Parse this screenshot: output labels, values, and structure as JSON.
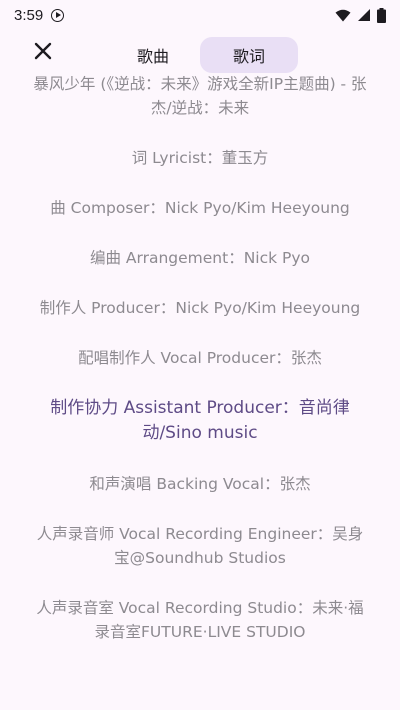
{
  "status": {
    "time": "3:59",
    "icons": [
      "media-play-icon",
      "wifi-icon",
      "signal-icon",
      "battery-icon"
    ]
  },
  "tabs": [
    {
      "label": "歌曲",
      "selected": false
    },
    {
      "label": "歌词",
      "selected": true
    }
  ],
  "lyrics": [
    "暴风少年 (《逆战：未来》游戏全新IP主题曲) - 张杰/逆战：未来",
    "词 Lyricist：董玉方",
    "曲 Composer：Nick Pyo/Kim Heeyoung",
    "编曲 Arrangement：Nick Pyo",
    "制作人 Producer：Nick Pyo/Kim Heeyoung",
    "配唱制作人 Vocal Producer：张杰",
    "制作协力 Assistant Producer：音尚律动/Sino music",
    "和声演唱 Backing Vocal：张杰",
    "人声录音师 Vocal Recording Engineer：吴身宝@Soundhub Studios",
    "人声录音室 Vocal Recording Studio：未来·福录音室FUTURE·LIVE STUDIO"
  ],
  "active_line_index": 6,
  "colors": {
    "background": "#fdf7fd",
    "selected_tab": "#e9dff5",
    "active_lyric": "#5e4b86",
    "inactive_lyric": "#8d8a90"
  }
}
